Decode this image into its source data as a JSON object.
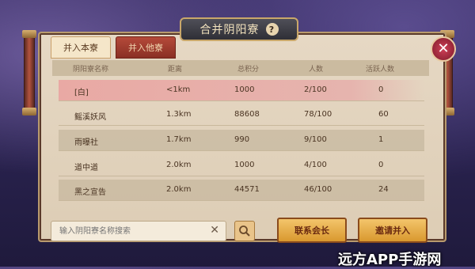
{
  "dialog": {
    "title": "合并阴阳寮",
    "help_symbol": "?",
    "close_symbol": "✕"
  },
  "tabs": [
    {
      "label": "并入本寮",
      "active": true
    },
    {
      "label": "并入他寮",
      "active": false
    }
  ],
  "table": {
    "columns": [
      "阴阳寮名称",
      "距离",
      "总积分",
      "人数",
      "活跃人数"
    ],
    "rows": [
      {
        "name": "[白]",
        "distance": "<1km",
        "score": "1000",
        "members": "2/100",
        "active": "0"
      },
      {
        "name": "鳐溪妖风",
        "distance": "1.3km",
        "score": "88608",
        "members": "78/100",
        "active": "60"
      },
      {
        "name": "雨曝社",
        "distance": "1.7km",
        "score": "990",
        "members": "9/100",
        "active": "1"
      },
      {
        "name": "道中道",
        "distance": "2.0km",
        "score": "1000",
        "members": "4/100",
        "active": "0"
      },
      {
        "name": "黑之宣告",
        "distance": "2.0km",
        "score": "44571",
        "members": "46/100",
        "active": "24"
      }
    ]
  },
  "search": {
    "placeholder": "输入阴阳寮名称搜索",
    "value": "",
    "clear_symbol": "✕"
  },
  "buttons": {
    "contact": "联系会长",
    "invite": "邀请并入"
  },
  "watermark": "远方APP手游网",
  "colors": {
    "panel": "#e6d8c4",
    "highlight_row": "#e9a9a4",
    "accent_button": "#f3c56b",
    "close": "#cf3f56"
  }
}
